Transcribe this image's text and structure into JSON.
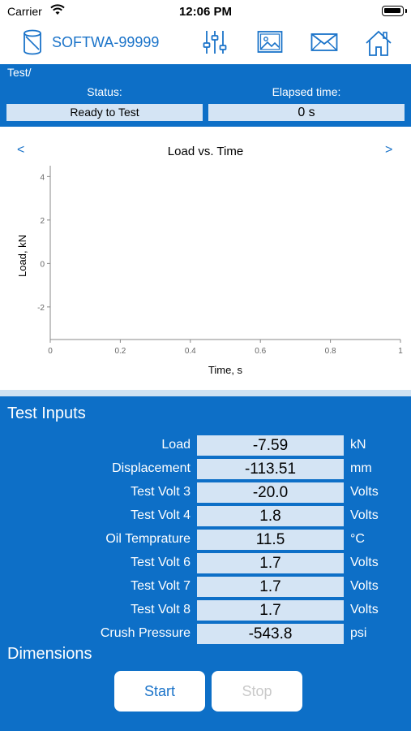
{
  "status_bar": {
    "carrier": "Carrier",
    "time": "12:06 PM"
  },
  "toolbar": {
    "device_name": "SOFTWA-99999",
    "icons": [
      "device-icon",
      "sliders-icon",
      "image-icon",
      "mail-icon",
      "home-icon"
    ]
  },
  "header": {
    "path": "Test/",
    "status_label": "Status:",
    "status_value": "Ready to Test",
    "elapsed_label": "Elapsed time:",
    "elapsed_value": "0 s"
  },
  "chart_nav": {
    "prev": "<",
    "next": ">"
  },
  "chart_data": {
    "type": "line",
    "title": "Load vs. Time",
    "xlabel": "Time, s",
    "ylabel": "Load, kN",
    "xlim": [
      0,
      1
    ],
    "ylim": [
      -3.5,
      4.5
    ],
    "xticks": [
      0,
      0.2,
      0.4,
      0.6,
      0.8,
      1
    ],
    "xtick_labels": [
      "0",
      "0.2",
      "0.4",
      "0.6",
      "0.8",
      "1"
    ],
    "yticks": [
      -2,
      0,
      2,
      4
    ],
    "ytick_labels": [
      "-2",
      "0",
      "2",
      "4"
    ],
    "grid": false,
    "series": []
  },
  "inputs": {
    "title": "Test Inputs",
    "rows": [
      {
        "label": "Load",
        "value": "-7.59",
        "unit": "kN"
      },
      {
        "label": "Displacement",
        "value": "-113.51",
        "unit": "mm"
      },
      {
        "label": "Test Volt 3",
        "value": "-20.0",
        "unit": "Volts"
      },
      {
        "label": "Test Volt 4",
        "value": "1.8",
        "unit": "Volts"
      },
      {
        "label": "Oil Temprature",
        "value": "11.5",
        "unit": "°C"
      },
      {
        "label": "Test Volt 6",
        "value": "1.7",
        "unit": "Volts"
      },
      {
        "label": "Test Volt 7",
        "value": "1.7",
        "unit": "Volts"
      },
      {
        "label": "Test Volt 8",
        "value": "1.7",
        "unit": "Volts"
      },
      {
        "label": "Crush Pressure",
        "value": "-543.8",
        "unit": "psi"
      }
    ]
  },
  "dimensions": {
    "title": "Dimensions"
  },
  "buttons": {
    "start": "Start",
    "stop": "Stop"
  },
  "colors": {
    "accent": "#0d6fc7",
    "field": "#d4e4f4",
    "link": "#1a73c9"
  }
}
